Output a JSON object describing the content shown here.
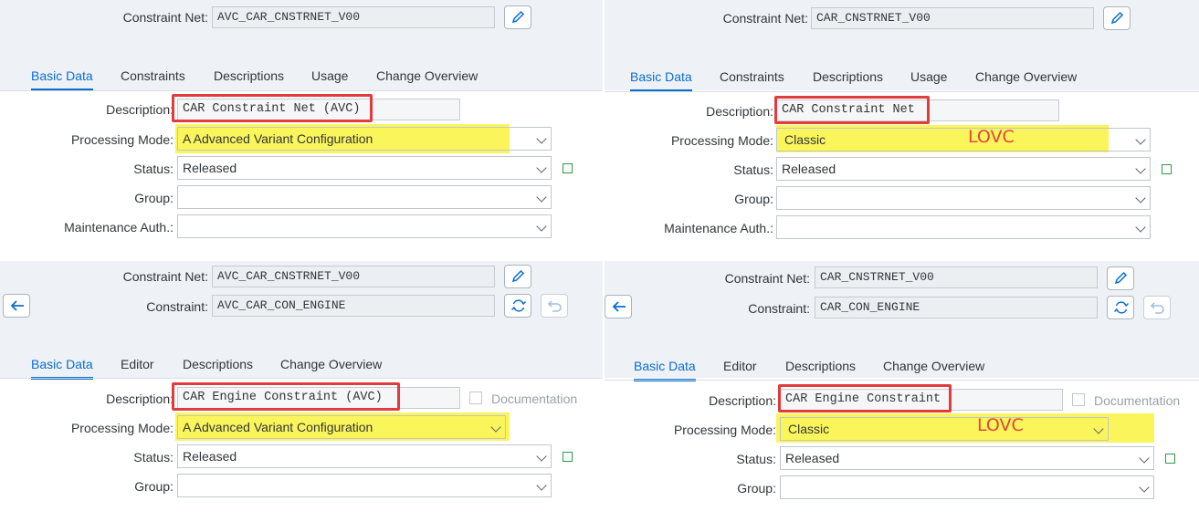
{
  "panels": {
    "p1": {
      "net_label": "Constraint Net:",
      "net_value": "AVC_CAR_CNSTRNET_V00",
      "tabs": [
        "Basic Data",
        "Constraints",
        "Descriptions",
        "Usage",
        "Change Overview"
      ],
      "labels": {
        "description": "Description:",
        "processing_mode": "Processing Mode:",
        "status": "Status:",
        "group": "Group:",
        "maintenance_auth": "Maintenance Auth.:"
      },
      "description": "CAR Constraint Net (AVC)",
      "processing_mode": "A Advanced Variant Configuration",
      "status": "Released",
      "group": "",
      "maintenance_auth": ""
    },
    "p2": {
      "net_label": "Constraint Net:",
      "net_value": "CAR_CNSTRNET_V00",
      "tabs": [
        "Basic Data",
        "Constraints",
        "Descriptions",
        "Usage",
        "Change Overview"
      ],
      "labels": {
        "description": "Description:",
        "processing_mode": "Processing Mode:",
        "status": "Status:",
        "group": "Group:",
        "maintenance_auth": "Maintenance Auth.:"
      },
      "description": "CAR Constraint Net",
      "processing_mode": "Classic",
      "annotation": "LOVC",
      "status": "Released",
      "group": "",
      "maintenance_auth": ""
    },
    "p3": {
      "net_label": "Constraint Net:",
      "net_value": "AVC_CAR_CNSTRNET_V00",
      "constraint_label": "Constraint:",
      "constraint_value": "AVC_CAR_CON_ENGINE",
      "tabs": [
        "Basic Data",
        "Editor",
        "Descriptions",
        "Change Overview"
      ],
      "labels": {
        "description": "Description:",
        "processing_mode": "Processing Mode:",
        "status": "Status:",
        "group": "Group:"
      },
      "description": "CAR Engine Constraint (AVC)",
      "documentation": "Documentation",
      "processing_mode": "A Advanced Variant Configuration",
      "status": "Released",
      "group": ""
    },
    "p4": {
      "net_label": "Constraint Net:",
      "net_value": "CAR_CNSTRNET_V00",
      "constraint_label": "Constraint:",
      "constraint_value": "CAR_CON_ENGINE",
      "tabs": [
        "Basic Data",
        "Editor",
        "Descriptions",
        "Change Overview"
      ],
      "labels": {
        "description": "Description:",
        "processing_mode": "Processing Mode:",
        "status": "Status:",
        "group": "Group:"
      },
      "description": "CAR Engine Constraint",
      "documentation": "Documentation",
      "processing_mode": "Classic",
      "annotation": "LOVC",
      "status": "Released",
      "group": ""
    }
  },
  "icons": {
    "edit": "pencil-icon",
    "refresh": "refresh-icon",
    "undo": "undo-icon",
    "back": "back-arrow-icon",
    "dropdown": "chevron-down-icon"
  },
  "colors": {
    "accent": "#0a6ed1",
    "highlight": "#fbf55c",
    "annotation_red": "#e33b3b",
    "status_green": "#2f9a46"
  }
}
